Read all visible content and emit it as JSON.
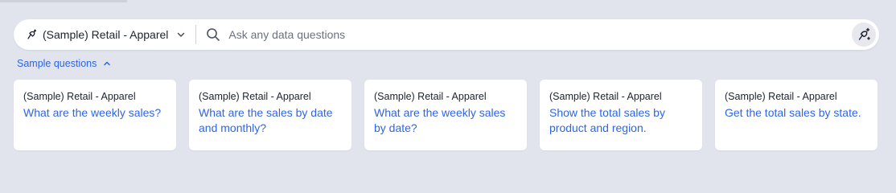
{
  "search": {
    "source_label": "(Sample) Retail - Apparel",
    "placeholder": "Ask any data questions"
  },
  "sample_toggle_label": "Sample questions",
  "cards": [
    {
      "source": "(Sample) Retail - Apparel",
      "question": "What are the weekly sales?"
    },
    {
      "source": "(Sample) Retail - Apparel",
      "question": "What are the sales by date and monthly?"
    },
    {
      "source": "(Sample) Retail - Apparel",
      "question": "What are the weekly sales by date?"
    },
    {
      "source": "(Sample) Retail - Apparel",
      "question": "Show the total sales by product and region."
    },
    {
      "source": "(Sample) Retail - Apparel",
      "question": "Get the total sales by state."
    }
  ],
  "colors": {
    "background": "#e1e4ec",
    "accent": "#2e65e8",
    "text": "#1d232f"
  },
  "icons": {
    "source": "ai-source-icon",
    "dropdown": "chevron-down-icon",
    "search": "search-icon",
    "ai_button": "sparkle-ai-icon",
    "toggle": "chevron-up-icon"
  }
}
